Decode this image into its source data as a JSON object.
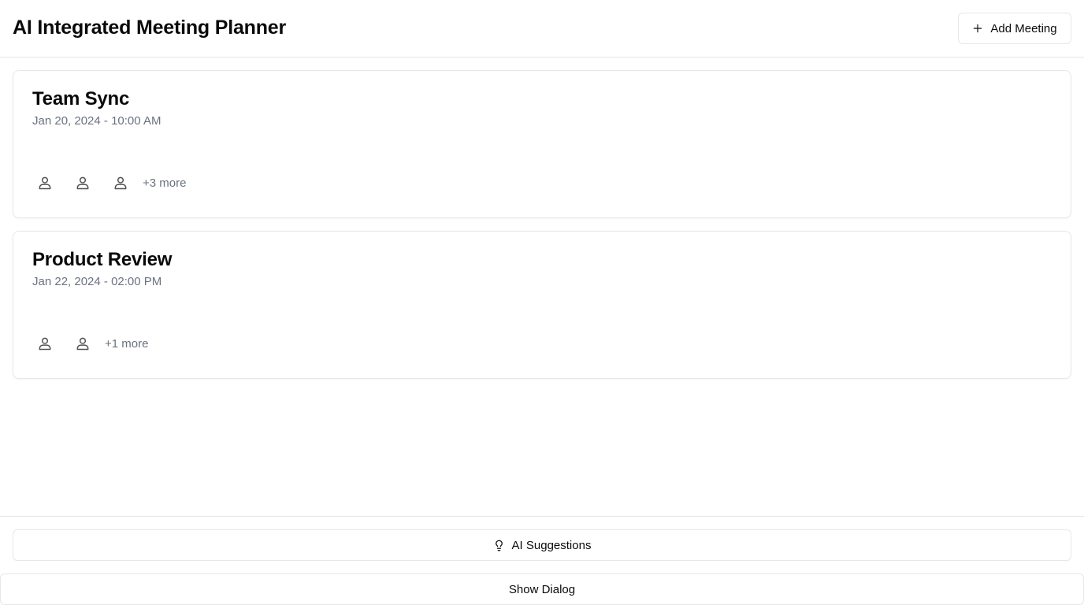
{
  "app": {
    "title": "AI Integrated Meeting Planner"
  },
  "header": {
    "add_meeting_label": "Add Meeting",
    "add_icon": "plus-icon"
  },
  "meetings": [
    {
      "title": "Team Sync",
      "datetime": "Jan 20, 2024 - 10:00 AM",
      "attendee_icons": [
        "user-icon",
        "user-icon",
        "user-icon"
      ],
      "more_label": "+3 more"
    },
    {
      "title": "Product Review",
      "datetime": "Jan 22, 2024 - 02:00 PM",
      "attendee_icons": [
        "user-icon",
        "user-icon"
      ],
      "more_label": "+1 more"
    }
  ],
  "footer": {
    "ai_suggestions_label": "AI Suggestions",
    "ai_icon": "lightbulb-icon",
    "show_dialog_label": "Show Dialog"
  },
  "colors": {
    "text": "#0a0a0a",
    "muted": "#6b7280",
    "border": "#e5e7eb",
    "background": "#ffffff"
  }
}
